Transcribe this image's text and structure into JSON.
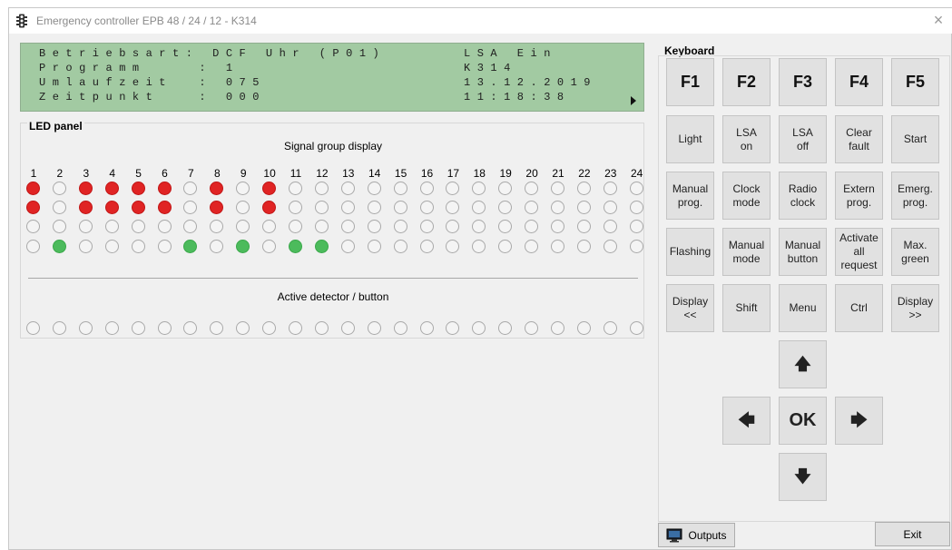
{
  "window": {
    "title": "Emergency controller EPB 48 / 24 / 12 - K314",
    "close_glyph": "×",
    "app_icon": "traffic-light-icon"
  },
  "lcd": {
    "rows": [
      {
        "left": "Betriebsart: DCF Uhr (P01)",
        "right": "LSA Ein"
      },
      {
        "left": "Programm    : 1",
        "right": "K314"
      },
      {
        "left": "Umlaufzeit  : 075",
        "right": "13.12.2019"
      },
      {
        "left": "Zeitpunkt   : 000",
        "right": "11:18:38"
      }
    ]
  },
  "led_panel": {
    "title": "LED panel",
    "signal_group_label": "Signal group display",
    "detector_label": "Active detector / button",
    "columns": [
      "1",
      "2",
      "3",
      "4",
      "5",
      "6",
      "7",
      "8",
      "9",
      "10",
      "11",
      "12",
      "13",
      "14",
      "15",
      "16",
      "17",
      "18",
      "19",
      "20",
      "21",
      "22",
      "23",
      "24"
    ],
    "signal_rows": [
      [
        "red",
        "off",
        "red",
        "red",
        "red",
        "red",
        "off",
        "red",
        "off",
        "red",
        "off",
        "off",
        "off",
        "off",
        "off",
        "off",
        "off",
        "off",
        "off",
        "off",
        "off",
        "off",
        "off",
        "off"
      ],
      [
        "red",
        "off",
        "red",
        "red",
        "red",
        "red",
        "off",
        "red",
        "off",
        "red",
        "off",
        "off",
        "off",
        "off",
        "off",
        "off",
        "off",
        "off",
        "off",
        "off",
        "off",
        "off",
        "off",
        "off"
      ],
      [
        "off",
        "off",
        "off",
        "off",
        "off",
        "off",
        "off",
        "off",
        "off",
        "off",
        "off",
        "off",
        "off",
        "off",
        "off",
        "off",
        "off",
        "off",
        "off",
        "off",
        "off",
        "off",
        "off",
        "off"
      ],
      [
        "off",
        "green",
        "off",
        "off",
        "off",
        "off",
        "green",
        "off",
        "green",
        "off",
        "green",
        "green",
        "off",
        "off",
        "off",
        "off",
        "off",
        "off",
        "off",
        "off",
        "off",
        "off",
        "off",
        "off"
      ]
    ],
    "detector_row": [
      "off",
      "off",
      "off",
      "off",
      "off",
      "off",
      "off",
      "off",
      "off",
      "off",
      "off",
      "off",
      "off",
      "off",
      "off",
      "off",
      "off",
      "off",
      "off",
      "off",
      "off",
      "off",
      "off",
      "off"
    ]
  },
  "keyboard": {
    "title": "Keyboard",
    "rows": [
      [
        {
          "name": "f1",
          "label": "F1",
          "fn": true
        },
        {
          "name": "f2",
          "label": "F2",
          "fn": true
        },
        {
          "name": "f3",
          "label": "F3",
          "fn": true
        },
        {
          "name": "f4",
          "label": "F4",
          "fn": true
        },
        {
          "name": "f5",
          "label": "F5",
          "fn": true
        }
      ],
      [
        {
          "name": "light",
          "label": "Light"
        },
        {
          "name": "lsa-on",
          "label": "LSA\non"
        },
        {
          "name": "lsa-off",
          "label": "LSA\noff"
        },
        {
          "name": "clear-fault",
          "label": "Clear\nfault"
        },
        {
          "name": "start",
          "label": "Start"
        }
      ],
      [
        {
          "name": "manual-prog",
          "label": "Manual\nprog."
        },
        {
          "name": "clock-mode",
          "label": "Clock\nmode"
        },
        {
          "name": "radio-clock",
          "label": "Radio\nclock"
        },
        {
          "name": "extern-prog",
          "label": "Extern\nprog."
        },
        {
          "name": "emerg-prog",
          "label": "Emerg.\nprog."
        }
      ],
      [
        {
          "name": "flashing",
          "label": "Flashing"
        },
        {
          "name": "manual-mode",
          "label": "Manual\nmode"
        },
        {
          "name": "manual-button",
          "label": "Manual\nbutton"
        },
        {
          "name": "activate-all-request",
          "label": "Activate\nall\nrequest"
        },
        {
          "name": "max-green",
          "label": "Max.\ngreen"
        }
      ],
      [
        {
          "name": "display-back",
          "label": "Display\n<<"
        },
        {
          "name": "shift",
          "label": "Shift"
        },
        {
          "name": "menu",
          "label": "Menu"
        },
        {
          "name": "ctrl",
          "label": "Ctrl"
        },
        {
          "name": "display-forward",
          "label": "Display\n>>"
        }
      ]
    ],
    "arrows": {
      "up": "🡅",
      "left": "🡄",
      "ok": "OK",
      "right": "🡆",
      "down": "🡇"
    }
  },
  "footer": {
    "outputs_label": "Outputs",
    "outputs_icon": "monitor-icon",
    "exit_label": "Exit"
  },
  "colors": {
    "lcd_bg": "#a2caa2",
    "led_red": "#e02424",
    "led_green": "#4cbb5c",
    "led_off": "#f4f4f4"
  }
}
